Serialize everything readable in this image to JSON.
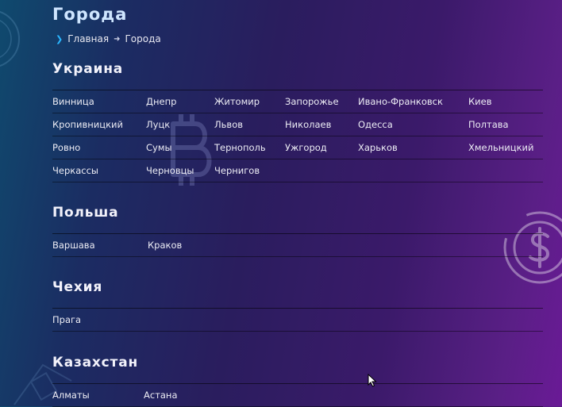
{
  "page": {
    "title": "Города",
    "breadcrumb": [
      {
        "label": "Главная"
      },
      {
        "label": "Города"
      }
    ]
  },
  "icons": {
    "breadcrumb_chevron": "chevron-right-icon",
    "breadcrumb_separator": "arrow-right-icon",
    "bg_bitcoin": "bitcoin-icon",
    "bg_dollar": "dollar-icon"
  },
  "colors": {
    "title": "#cfe6ff",
    "accent": "#2ab7ff"
  },
  "sections": [
    {
      "title": "Украина",
      "rows": [
        [
          "Винница",
          "Днепр",
          "Житомир",
          "Запорожье",
          "Ивано-Франковск",
          "Киев"
        ],
        [
          "Кропивницкий",
          "Луцк",
          "Львов",
          "Николаев",
          "Одесса",
          "Полтава"
        ],
        [
          "Ровно",
          "Сумы",
          "Тернополь",
          "Ужгород",
          "Харьков",
          "Хмельницкий"
        ],
        [
          "Черкассы",
          "Черновцы",
          "Чернигов"
        ]
      ]
    },
    {
      "title": "Польша",
      "rows": [
        [
          "Варшава",
          "Краков"
        ]
      ]
    },
    {
      "title": "Чехия",
      "rows": [
        [
          "Прага"
        ]
      ]
    },
    {
      "title": "Казахстан",
      "rows": [
        [
          "Алматы",
          "Астана"
        ]
      ]
    }
  ]
}
